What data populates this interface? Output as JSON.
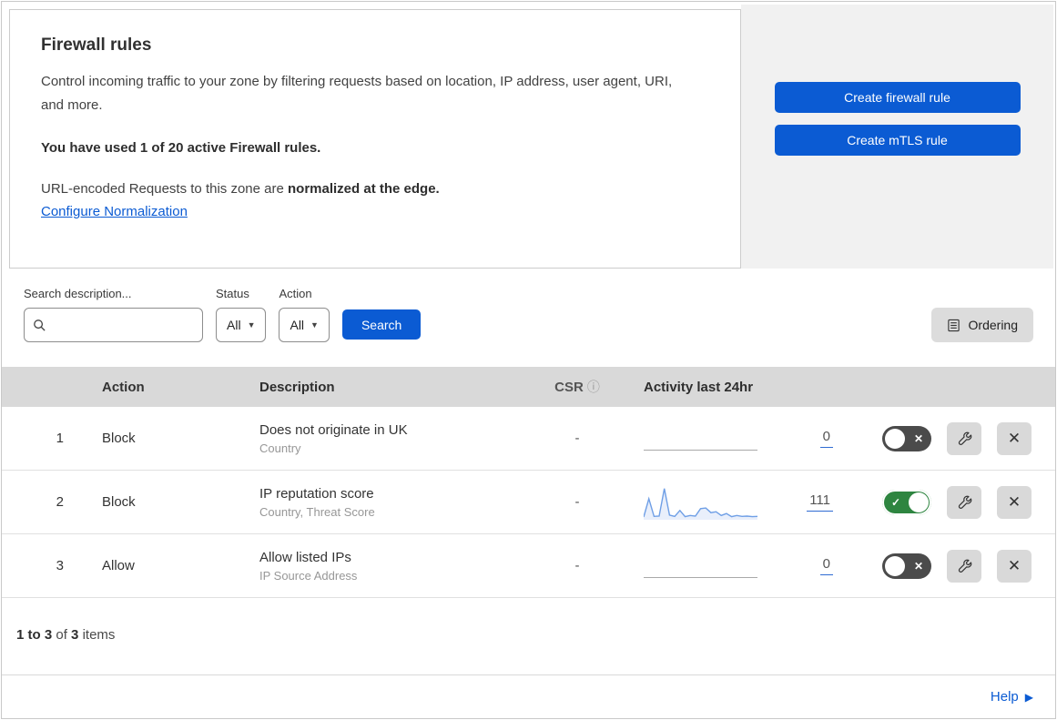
{
  "intro": {
    "title": "Firewall rules",
    "description": "Control incoming traffic to your zone by filtering requests based on location, IP address, user agent, URI, and more.",
    "usage": "You have used 1 of 20 active Firewall rules.",
    "normalization_prefix": "URL-encoded Requests to this zone are ",
    "normalization_bold": "normalized at the edge.",
    "normalization_link": "Configure Normalization",
    "create_firewall_button": "Create firewall rule",
    "create_mtls_button": "Create mTLS rule"
  },
  "filters": {
    "search_label": "Search description...",
    "status_label": "Status",
    "status_value": "All",
    "action_label": "Action",
    "action_value": "All",
    "search_button": "Search",
    "ordering_button": "Ordering"
  },
  "table": {
    "columns": {
      "action": "Action",
      "description": "Description",
      "csr": "CSR",
      "csr_info_icon": "ⓘ",
      "activity": "Activity last 24hr"
    },
    "rows": [
      {
        "num": "1",
        "action": "Block",
        "description": "Does not originate in UK",
        "criteria": "Country",
        "csr": "-",
        "activity_count": "0",
        "enabled": false,
        "sparkline": []
      },
      {
        "num": "2",
        "action": "Block",
        "description": "IP reputation score",
        "criteria": "Country, Threat Score",
        "csr": "-",
        "activity_count": "111",
        "enabled": true,
        "sparkline": [
          3,
          62,
          5,
          6,
          95,
          9,
          5,
          24,
          4,
          8,
          6,
          30,
          32,
          17,
          20,
          8,
          14,
          4,
          8,
          5,
          6,
          4,
          5
        ]
      },
      {
        "num": "3",
        "action": "Allow",
        "description": "Allow listed IPs",
        "criteria": "IP Source Address",
        "csr": "-",
        "activity_count": "0",
        "enabled": false,
        "sparkline": []
      }
    ]
  },
  "footer": {
    "range": "1 to 3",
    "of_text": "of",
    "total": "3",
    "items_text": "items",
    "help_label": "Help"
  },
  "colors": {
    "primary_blue": "#0b5bd3",
    "link_blue": "#0b5bd3",
    "toggle_on_green": "#2e8540",
    "toggle_off_gray": "#4b4b4b",
    "sparkline_stroke": "#6f9fe6",
    "sparkline_fill": "#e9effb",
    "header_gray": "#d9d9d9"
  }
}
